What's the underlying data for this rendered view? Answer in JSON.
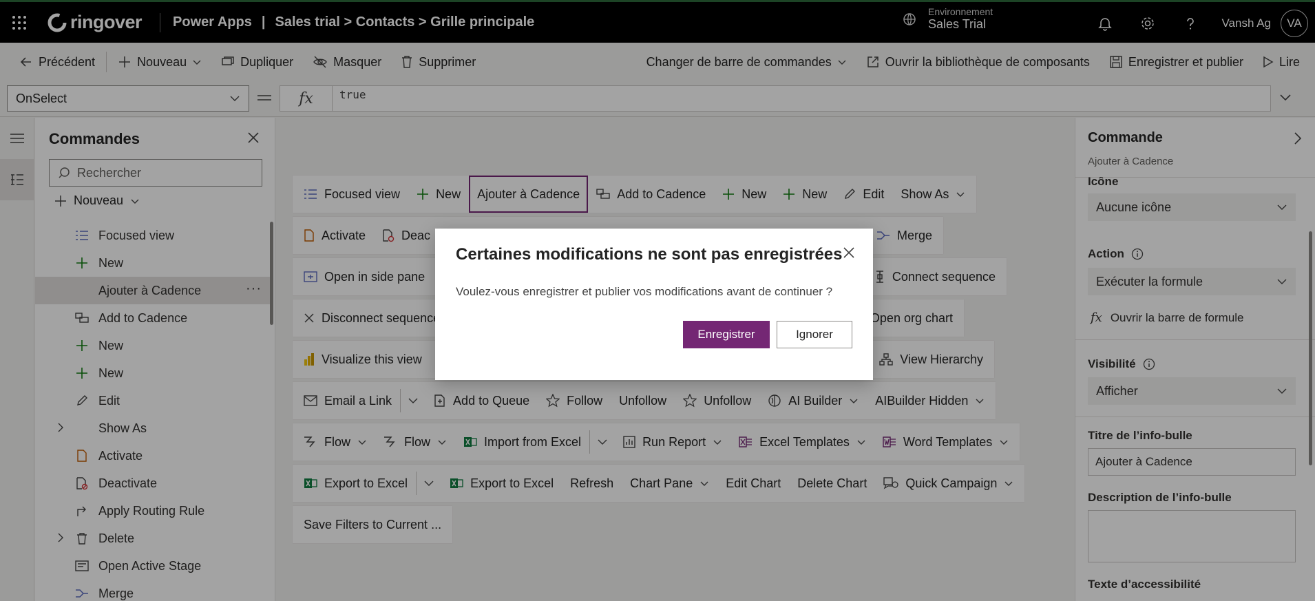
{
  "topbar": {
    "brand": "ringover",
    "app_title": "Power Apps",
    "separator": "|",
    "breadcrumb": "Sales trial > Contacts > Grille principale",
    "environment_label": "Environnement",
    "environment_value": "Sales Trial",
    "user_name": "Vansh Ag",
    "avatar_initials": "VA"
  },
  "toolbar": {
    "back": "Précédent",
    "new": "Nouveau",
    "duplicate": "Dupliquer",
    "hide": "Masquer",
    "delete": "Supprimer",
    "change_bar": "Changer de barre de commandes",
    "open_library": "Ouvrir la bibliothèque de composants",
    "save_publish": "Enregistrer et publier",
    "play": "Lire"
  },
  "formula_bar": {
    "property": "OnSelect",
    "equals": "=",
    "fx": "fx",
    "formula": "true"
  },
  "tree": {
    "title": "Commandes",
    "search_placeholder": "Rechercher",
    "new_label": "Nouveau",
    "items": [
      {
        "label": "Focused view",
        "icon": "list-icon"
      },
      {
        "label": "New",
        "icon": "plus-icon"
      },
      {
        "label": "Ajouter à Cadence",
        "icon": "none",
        "selected": true
      },
      {
        "label": "Add to Cadence",
        "icon": "cadence-icon"
      },
      {
        "label": "New",
        "icon": "plus-icon"
      },
      {
        "label": "New",
        "icon": "plus-icon"
      },
      {
        "label": "Edit",
        "icon": "pencil-icon"
      },
      {
        "label": "Show As",
        "icon": "none",
        "expandable": true
      },
      {
        "label": "Activate",
        "icon": "document-icon"
      },
      {
        "label": "Deactivate",
        "icon": "document-blocked-icon"
      },
      {
        "label": "Apply Routing Rule",
        "icon": "routing-icon"
      },
      {
        "label": "Delete",
        "icon": "trash-icon",
        "expandable": true
      },
      {
        "label": "Open Active Stage",
        "icon": "stage-icon"
      },
      {
        "label": "Merge",
        "icon": "merge-icon"
      }
    ]
  },
  "canvas": {
    "rows": [
      [
        "Focused view",
        "New",
        "Ajouter à Cadence",
        "Add to Cadence",
        "New",
        "New",
        "Edit",
        "Show As"
      ],
      [
        "Activate",
        "Deac",
        "Merge"
      ],
      [
        "Open in side pane",
        "Connect sequence"
      ],
      [
        "Disconnect sequence",
        "Open org chart"
      ],
      [
        "Visualize this view",
        "View Hierarchy"
      ],
      [
        "Email a Link",
        "Add to Queue",
        "Follow",
        "Unfollow",
        "Unfollow",
        "AI Builder",
        "AIBuilder Hidden"
      ],
      [
        "Flow",
        "Flow",
        "Import from Excel",
        "Run Report",
        "Excel Templates",
        "Word Templates"
      ],
      [
        "Export to Excel",
        "Export to Excel",
        "Refresh",
        "Chart Pane",
        "Edit Chart",
        "Delete Chart",
        "Quick Campaign"
      ],
      [
        "Save Filters to Current ..."
      ]
    ]
  },
  "right_panel": {
    "title": "Commande",
    "subtitle": "Ajouter à Cadence",
    "icon_label": "Icône",
    "icon_value": "Aucune icône",
    "action_label": "Action",
    "action_value": "Exécuter la formule",
    "open_formula": "Ouvrir la barre de formule",
    "visibility_label": "Visibilité",
    "visibility_value": "Afficher",
    "tooltip_title_label": "Titre de l’info-bulle",
    "tooltip_title_value": "Ajouter à Cadence",
    "tooltip_desc_label": "Description de l’info-bulle",
    "accessibility_label": "Texte d’accessibilité"
  },
  "dialog": {
    "title": "Certaines modifications ne sont pas enregistrées",
    "body": "Voulez-vous enregistrer et publier vos modifications avant de continuer ?",
    "primary": "Enregistrer",
    "secondary": "Ignorer"
  },
  "colors": {
    "accent": "#742774",
    "topbar": "#000000",
    "overlay": "rgba(0,0,0,0.36)"
  }
}
